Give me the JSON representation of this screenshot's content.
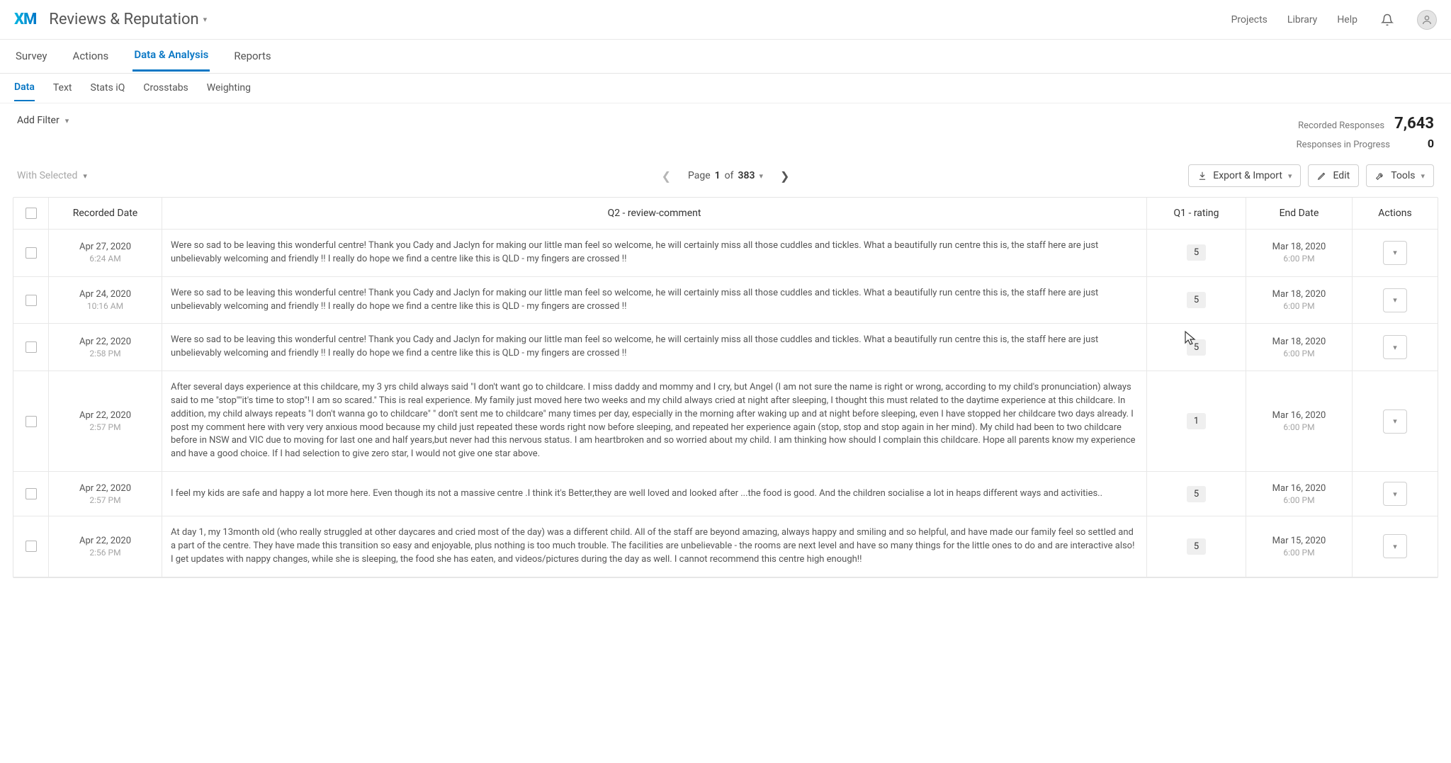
{
  "header": {
    "logo": "XM",
    "app_name": "Reviews & Reputation",
    "links": {
      "projects": "Projects",
      "library": "Library",
      "help": "Help"
    }
  },
  "main_tabs": {
    "survey": "Survey",
    "actions": "Actions",
    "da": "Data & Analysis",
    "reports": "Reports"
  },
  "sub_tabs": {
    "data": "Data",
    "text": "Text",
    "stats": "Stats iQ",
    "crosstabs": "Crosstabs",
    "weighting": "Weighting"
  },
  "filter": {
    "add": "Add Filter"
  },
  "counts": {
    "recorded_label": "Recorded Responses",
    "recorded_value": "7,643",
    "progress_label": "Responses in Progress",
    "progress_value": "0"
  },
  "toolbar": {
    "with_selected": "With Selected",
    "page_prefix": "Page ",
    "page_num": "1",
    "page_of": " of ",
    "page_total": "383",
    "export": "Export & Import",
    "edit": "Edit",
    "tools": "Tools"
  },
  "columns": {
    "date": "Recorded Date",
    "comment": "Q2 - review-comment",
    "rating": "Q1 - rating",
    "end": "End Date",
    "actions": "Actions"
  },
  "rows": [
    {
      "date": "Apr 27, 2020",
      "time": "6:24 AM",
      "comment": "Were so sad to be leaving this wonderful centre! Thank you Cady and Jaclyn for making our little man feel so welcome, he will certainly miss all those cuddles and tickles. What a beautifully run centre this is, the staff here are just unbelievably welcoming and friendly !! I really do hope we find a centre like this is QLD - my fingers are crossed !!",
      "rating": "5",
      "end_date": "Mar 18, 2020",
      "end_time": "6:00 PM"
    },
    {
      "date": "Apr 24, 2020",
      "time": "10:16 AM",
      "comment": "Were so sad to be leaving this wonderful centre! Thank you Cady and Jaclyn for making our little man feel so welcome, he will certainly miss all those cuddles and tickles. What a beautifully run centre this is, the staff here are just unbelievably welcoming and friendly !! I really do hope we find a centre like this is QLD - my fingers are crossed !!",
      "rating": "5",
      "end_date": "Mar 18, 2020",
      "end_time": "6:00 PM"
    },
    {
      "date": "Apr 22, 2020",
      "time": "2:58 PM",
      "comment": "Were so sad to be leaving this wonderful centre! Thank you Cady and Jaclyn for making our little man feel so welcome, he will certainly miss all those cuddles and tickles. What a beautifully run centre this is, the staff here are just unbelievably welcoming and friendly !! I really do hope we find a centre like this is QLD - my fingers are crossed !!",
      "rating": "5",
      "end_date": "Mar 18, 2020",
      "end_time": "6:00 PM"
    },
    {
      "date": "Apr 22, 2020",
      "time": "2:57 PM",
      "comment": "After several days experience at this childcare, my 3 yrs child always said \"I don't want go to childcare. I miss daddy and mommy and I cry, but Angel (I am not sure the name is right or wrong, according to my child's pronunciation) always said to me \"stop\"\"it's time to stop\"! I am so scared.\" This is real experience. My family just moved here two weeks and my child always cried at night after sleeping, I thought this must related to the daytime experience at this childcare. In addition, my child always repeats \"I don't wanna go to childcare\" \" don't sent me to childcare\" many times per day, especially in the morning after waking up and at night before sleeping, even I have stopped her childcare two days already. I post my comment here with very very anxious mood because my child just repeated these words right now before sleeping, and repeated her experience again (stop, stop and stop again in her mind). My child had been to two childcare before in NSW and VIC due to moving for last one and half years,but never had this nervous status. I am heartbroken and so worried about my child. I am thinking how should I complain this childcare. Hope all parents know my experience and have a good choice. If I had selection to give zero star, I would not give one star above.",
      "rating": "1",
      "end_date": "Mar 16, 2020",
      "end_time": "6:00 PM"
    },
    {
      "date": "Apr 22, 2020",
      "time": "2:57 PM",
      "comment": "I feel my kids are safe and happy a lot more here. Even though its not a massive centre .I think it's Better,they are well loved and looked after ...the food is good. And the children socialise a lot in heaps different ways and activities..",
      "rating": "5",
      "end_date": "Mar 16, 2020",
      "end_time": "6:00 PM"
    },
    {
      "date": "Apr 22, 2020",
      "time": "2:56 PM",
      "comment": "At day 1, my 13month old (who really struggled at other daycares and cried most of the day) was a different child. All of the staff are beyond amazing, always happy and smiling and so helpful, and have made our family feel so settled and a part of the centre. They have made this transition so easy and enjoyable, plus nothing is too much trouble. The facilities are unbelievable - the rooms are next level and have so many things for the little ones to do and are interactive also! I get updates with nappy changes, while she is sleeping, the food she has eaten, and videos/pictures during the day as well. I cannot recommend this centre high enough!!",
      "rating": "5",
      "end_date": "Mar 15, 2020",
      "end_time": "6:00 PM"
    }
  ]
}
